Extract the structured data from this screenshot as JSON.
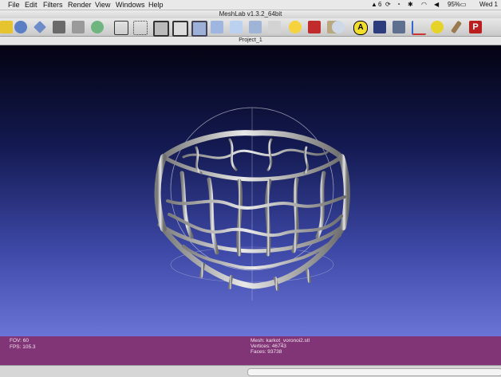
{
  "menubar": {
    "items": [
      "File",
      "Edit",
      "Filters",
      "Render",
      "View",
      "Windows",
      "Help"
    ],
    "wifi_badge": "6",
    "battery": "95%",
    "clock": "Wed 1"
  },
  "window": {
    "title": "MeshLab v1.3.2_64bit"
  },
  "tab": {
    "label": "Project_1"
  },
  "toolbar": {
    "icons": [
      "open-icon",
      "reload-icon",
      "export-icon",
      "snapshot-icon",
      "layers-icon",
      "trackball-icon",
      "bbox-icon",
      "points-icon",
      "wireframe-icon",
      "hidden-lines-icon",
      "flat-lines-icon",
      "flat-icon",
      "smooth-icon",
      "texture-icon",
      "lighting-icon",
      "vertex-color-icon",
      "face-color-icon",
      "sphere-icon",
      "annotation-icon",
      "measure-icon",
      "axes-icon",
      "paint-icon",
      "brush-icon",
      "pdf-icon"
    ]
  },
  "info": {
    "fov": "FOV: 60",
    "fps": "FPS:   105.3",
    "mesh": "Mesh: karkot_voronoi2.stl",
    "vertices": "Vertices: 46743",
    "faces": "Faces: 93738"
  },
  "colors": {
    "info_bg": "#813476",
    "viewport_top": "#030312",
    "viewport_bottom": "#6a74d6"
  }
}
